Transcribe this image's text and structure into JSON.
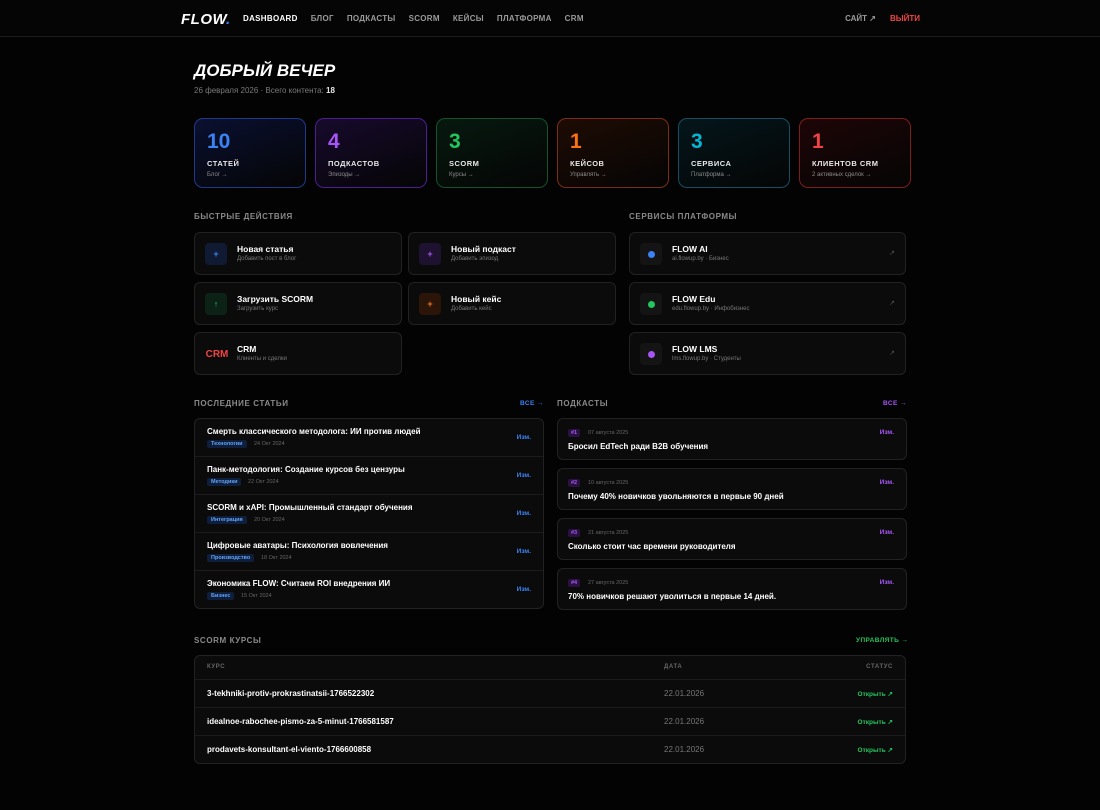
{
  "nav": {
    "logo": "FLOW",
    "logo_dot": ".",
    "links": [
      "DASHBOARD",
      "БЛОГ",
      "ПОДКАСТЫ",
      "SCORM",
      "КЕЙСЫ",
      "ПЛАТФОРМА",
      "CRM"
    ],
    "site": "САЙТ ↗",
    "logout": "ВЫЙТИ"
  },
  "header": {
    "greeting": "ДОБРЫЙ ВЕЧЕР",
    "date": "26 февраля 2026 · Всего контента:",
    "total": "18"
  },
  "stats": [
    {
      "num": "10",
      "label": "СТАТЕЙ",
      "sub": "Блог →",
      "color": "#3b82f6",
      "border": "#1f3a8a",
      "bg": "#0a1030"
    },
    {
      "num": "4",
      "label": "ПОДКАСТОВ",
      "sub": "Эпизоды →",
      "color": "#a855f7",
      "border": "#4c1d95",
      "bg": "#170a2c"
    },
    {
      "num": "3",
      "label": "SCORM",
      "sub": "Курсы →",
      "color": "#22c55e",
      "border": "#14532d",
      "bg": "#06190f"
    },
    {
      "num": "1",
      "label": "КЕЙСОВ",
      "sub": "Управлять →",
      "color": "#f97316",
      "border": "#7c2d12",
      "bg": "#1e0b04"
    },
    {
      "num": "3",
      "label": "СЕРВИСА",
      "sub": "Платформа →",
      "color": "#06b6d4",
      "border": "#164e63",
      "bg": "#04161b"
    },
    {
      "num": "1",
      "label": "КЛИЕНТОВ CRM",
      "sub": "2 активных сделок →",
      "color": "#ef4444",
      "border": "#7f1d1d",
      "bg": "#1e0506"
    }
  ],
  "quick": {
    "title": "БЫСТРЫЕ ДЕЙСТВИЯ",
    "items": [
      {
        "icon": "+",
        "title": "Новая статья",
        "sub": "Добавить пост в блог",
        "color": "#3b82f6",
        "bg": "#101a33"
      },
      {
        "icon": "+",
        "title": "Новый подкаст",
        "sub": "Добавить эпизод",
        "color": "#a855f7",
        "bg": "#1f1230"
      },
      {
        "icon": "↑",
        "title": "Загрузить SCORM",
        "sub": "Загрузить курс",
        "color": "#22c55e",
        "bg": "#0d2217"
      },
      {
        "icon": "+",
        "title": "Новый кейс",
        "sub": "Добавить кейс",
        "color": "#f97316",
        "bg": "#2a1508"
      },
      {
        "icon": "CRM",
        "title": "CRM",
        "sub": "Клиенты и сделки",
        "color": "#ef4444",
        "bg": "#0b0b0b"
      }
    ]
  },
  "services": {
    "title": "СЕРВИСЫ ПЛАТФОРМЫ",
    "items": [
      {
        "title": "FLOW AI",
        "sub": "ai.flowup.by · Бизнес",
        "color": "#3b82f6"
      },
      {
        "title": "FLOW Edu",
        "sub": "edu.flowup.by · Инфобизнес",
        "color": "#22c55e"
      },
      {
        "title": "FLOW LMS",
        "sub": "lms.flowup.by · Студенты",
        "color": "#a855f7"
      }
    ],
    "ext": "↗"
  },
  "articles": {
    "title": "ПОСЛЕДНИЕ СТАТЬИ",
    "all": "ВСЕ →",
    "edit": "Изм.",
    "items": [
      {
        "title": "Смерть классического методолога: ИИ против людей",
        "tag": "Технологии",
        "date": "24 Окт 2024"
      },
      {
        "title": "Панк-методология: Создание курсов без цензуры",
        "tag": "Методики",
        "date": "22 Окт 2024"
      },
      {
        "title": "SCORM и xAPI: Промышленный стандарт обучения",
        "tag": "Интеграция",
        "date": "20 Окт 2024"
      },
      {
        "title": "Цифровые аватары: Психология вовлечения",
        "tag": "Производство",
        "date": "18 Окт 2024"
      },
      {
        "title": "Экономика FLOW: Считаем ROI внедрения ИИ",
        "tag": "Бизнес",
        "date": "15 Окт 2024"
      }
    ]
  },
  "podcasts": {
    "title": "ПОДКАСТЫ",
    "all": "ВСЕ →",
    "edit": "Изм.",
    "items": [
      {
        "num": "#1",
        "date": "07 августа 2025",
        "title": "Бросил EdTech ради B2B обучения"
      },
      {
        "num": "#2",
        "date": "10 августа 2025",
        "title": "Почему 40% новичков увольняются в первые 90 дней"
      },
      {
        "num": "#3",
        "date": "21 августа 2025",
        "title": "Сколько стоит час времени руководителя"
      },
      {
        "num": "#4",
        "date": "27 августа 2025",
        "title": "70% новичков решают уволиться в первые 14 дней."
      }
    ]
  },
  "scorm": {
    "title": "SCORM КУРСЫ",
    "manage": "УПРАВЛЯТЬ →",
    "headers": {
      "course": "КУРС",
      "date": "ДАТА",
      "status": "СТАТУС"
    },
    "open": "Открыть ↗",
    "rows": [
      {
        "name": "3-tekhniki-protiv-prokrastinatsii-1766522302",
        "date": "22.01.2026"
      },
      {
        "name": "idealnoe-rabochee-pismo-za-5-minut-1766581587",
        "date": "22.01.2026"
      },
      {
        "name": "prodavets-konsultant-el-viento-1766600858",
        "date": "22.01.2026"
      }
    ]
  }
}
